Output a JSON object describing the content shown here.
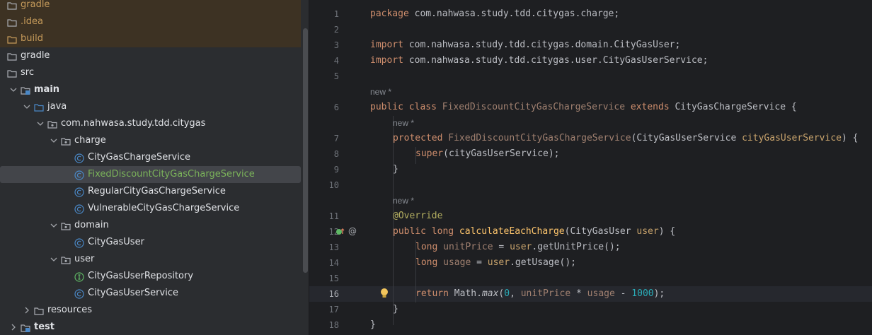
{
  "project_tree": [
    {
      "label": "gradle",
      "indent": 0,
      "type": "folder",
      "expanded": null,
      "style": "orange",
      "clipped_top": true
    },
    {
      "label": ".idea",
      "indent": 0,
      "type": "folder",
      "expanded": null,
      "style": "orange"
    },
    {
      "label": "build",
      "indent": 0,
      "type": "folder-orange",
      "expanded": null,
      "style": "orange"
    },
    {
      "label": "gradle",
      "indent": 0,
      "type": "folder",
      "expanded": null,
      "style": "normal"
    },
    {
      "label": "src",
      "indent": 0,
      "type": "folder",
      "expanded": null,
      "style": "normal"
    },
    {
      "label": "main",
      "indent": 1,
      "type": "module",
      "expanded": true,
      "style": "bold"
    },
    {
      "label": "java",
      "indent": 2,
      "type": "source-folder",
      "expanded": true,
      "style": "normal"
    },
    {
      "label": "com.nahwasa.study.tdd.citygas",
      "indent": 3,
      "type": "package",
      "expanded": true,
      "style": "normal"
    },
    {
      "label": "charge",
      "indent": 4,
      "type": "package",
      "expanded": true,
      "style": "normal"
    },
    {
      "label": "CityGasChargeService",
      "indent": 5,
      "type": "class",
      "expanded": null,
      "style": "normal"
    },
    {
      "label": "FixedDiscountCityGasChargeService",
      "indent": 5,
      "type": "class",
      "expanded": null,
      "style": "green",
      "selected": true
    },
    {
      "label": "RegularCityGasChargeService",
      "indent": 5,
      "type": "class",
      "expanded": null,
      "style": "normal"
    },
    {
      "label": "VulnerableCityGasChargeService",
      "indent": 5,
      "type": "class",
      "expanded": null,
      "style": "normal"
    },
    {
      "label": "domain",
      "indent": 4,
      "type": "package",
      "expanded": true,
      "style": "normal"
    },
    {
      "label": "CityGasUser",
      "indent": 5,
      "type": "class",
      "expanded": null,
      "style": "normal"
    },
    {
      "label": "user",
      "indent": 4,
      "type": "package",
      "expanded": true,
      "style": "normal"
    },
    {
      "label": "CityGasUserRepository",
      "indent": 5,
      "type": "interface",
      "expanded": null,
      "style": "normal"
    },
    {
      "label": "CityGasUserService",
      "indent": 5,
      "type": "class",
      "expanded": null,
      "style": "normal"
    },
    {
      "label": "resources",
      "indent": 2,
      "type": "folder",
      "expanded": false,
      "style": "normal"
    },
    {
      "label": "test",
      "indent": 1,
      "type": "module",
      "expanded": false,
      "style": "bold"
    }
  ],
  "editor": {
    "line_numbers": [
      "1",
      "2",
      "3",
      "4",
      "5",
      "6",
      "7",
      "8",
      "9",
      "10",
      "11",
      "12",
      "13",
      "14",
      "15",
      "16",
      "17",
      "18"
    ],
    "current_line": "16",
    "hints": {
      "new_star": "new *"
    },
    "code": {
      "l1": {
        "kw": "package",
        "rest": " com.nahwasa.study.tdd.citygas.charge;"
      },
      "l3": {
        "kw": "import",
        "rest": " com.nahwasa.study.tdd.citygas.domain.CityGasUser;"
      },
      "l4": {
        "kw": "import",
        "rest": " com.nahwasa.study.tdd.citygas.user.CityGasUserService;"
      },
      "l6": {
        "kw1": "public class",
        "name": "FixedDiscountCityGasChargeService",
        "kw2": "extends",
        "sup": "CityGasChargeService",
        "brace": "{"
      },
      "l7": {
        "kw": "protected",
        "name": "FixedDiscountCityGasChargeService",
        "open": "(",
        "ptype": "CityGasUserService",
        "pname": "cityGasUserService",
        "close": ") {"
      },
      "l8": {
        "kw": "super",
        "rest": "(cityGasUserService);"
      },
      "l9": {
        "text": "}"
      },
      "l11": {
        "annot": "@Override"
      },
      "l12": {
        "kw": "public long",
        "fn": "calculateEachCharge",
        "open": "(",
        "ptype": "CityGasUser",
        "pname": "user",
        "close": ") {"
      },
      "l13": {
        "kw": "long",
        "var": "unitPrice",
        "eq": " = ",
        "recv": "user",
        "call": ".getUnitPrice();"
      },
      "l14": {
        "kw": "long",
        "var": "usage",
        "eq": " = ",
        "recv": "user",
        "call": ".getUsage();"
      },
      "l16": {
        "kw": "return",
        "cls": "Math.",
        "fn": "max",
        "open": "(",
        "n0": "0",
        "comma": ", ",
        "v1": "unitPrice",
        "op": " * ",
        "v2": "usage",
        "minus": " - ",
        "n1": "1000",
        "close": ");"
      },
      "l17": {
        "text": "}"
      },
      "l18": {
        "text": "}"
      }
    }
  }
}
